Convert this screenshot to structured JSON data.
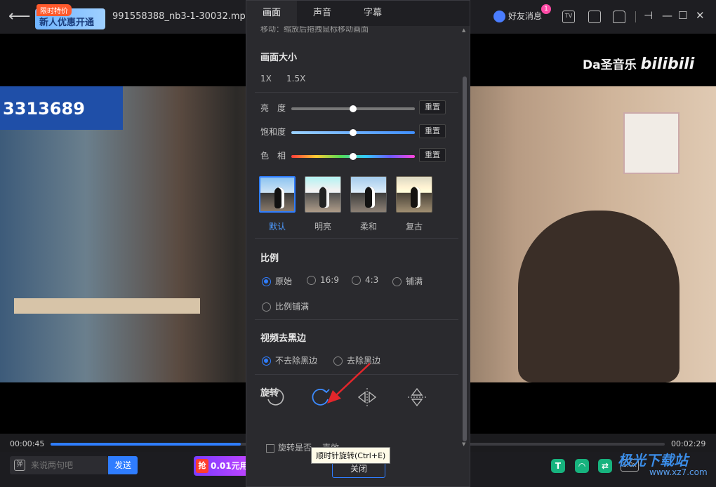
{
  "topbar": {
    "promo_tag": "限时特价",
    "promo_text": "新人优惠开通",
    "filename": "991558388_nb3-1-30032.mp4",
    "friend_label": "好友消息",
    "friend_badge": "1",
    "tv_icon_label": "TV"
  },
  "video": {
    "watermark": "Da圣音乐",
    "watermark_logo": "bilibili",
    "sign_text": "3313689"
  },
  "player": {
    "current_time": "00:00:45",
    "total_time": "00:02:29",
    "progress_fraction": 0.31,
    "chat_placeholder": "来说两句吧",
    "chat_icon": "弹",
    "send_label": "发送",
    "deal_tag": "抢",
    "deal_text": "0.01元用",
    "speed_label": "1.0x"
  },
  "panel": {
    "tabs": [
      {
        "label": "画面"
      },
      {
        "label": "声音"
      },
      {
        "label": "字幕"
      }
    ],
    "cut_text": "移动：缩放后拖拽鼠标移动画面",
    "size_title": "画面大小",
    "size_options": [
      "1X",
      "1.5X"
    ],
    "sliders": [
      {
        "label": "亮　度",
        "value": 0.5,
        "reset": "重置"
      },
      {
        "label": "饱和度",
        "value": 0.5,
        "reset": "重置"
      },
      {
        "label": "色　相",
        "value": 0.5,
        "reset": "重置"
      }
    ],
    "filters": [
      {
        "name": "默认",
        "selected": true
      },
      {
        "name": "明亮",
        "selected": false
      },
      {
        "name": "柔和",
        "selected": false
      },
      {
        "name": "复古",
        "selected": false
      }
    ],
    "ratio_title": "比例",
    "ratio_options": [
      "原始",
      "16:9",
      "4:3",
      "铺满",
      "比例铺满"
    ],
    "ratio_selected": "原始",
    "blackedge_title": "视频去黑边",
    "blackedge_options": [
      "不去除黑边",
      "去除黑边"
    ],
    "blackedge_selected": "不去除黑边",
    "rotate_title": "旋转",
    "rotate_checkbox": "旋转是否…",
    "close_label": "关闭",
    "tooltip": "顺时针旋转(Ctrl+E)",
    "partial_text": "声效"
  },
  "site_watermark": {
    "name": "极光下载站",
    "url": "www.xz7.com"
  },
  "colors": {
    "accent": "#2f7dff",
    "arrow": "#e3262b"
  }
}
